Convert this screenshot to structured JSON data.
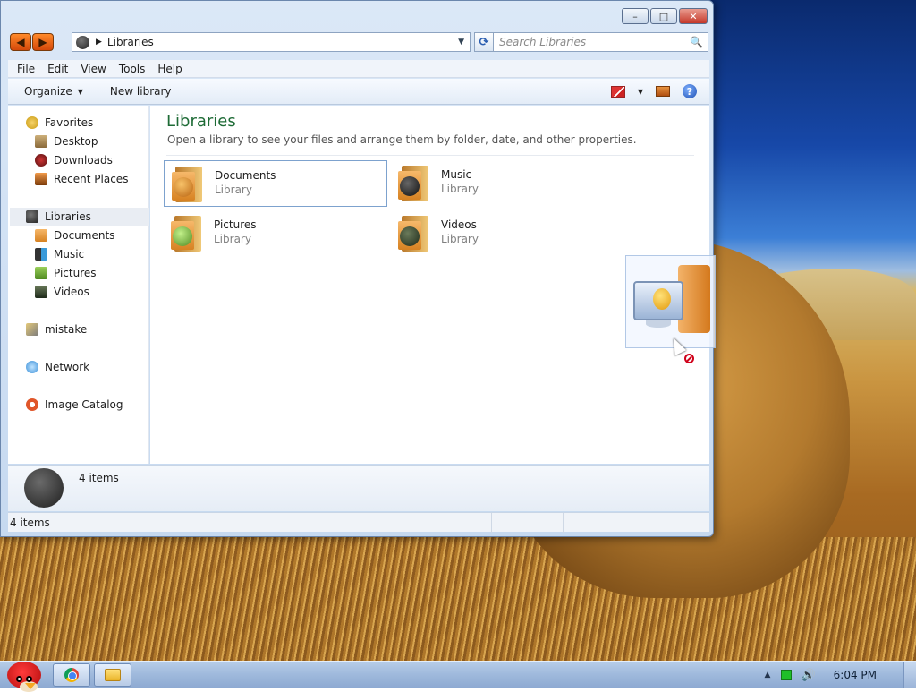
{
  "window": {
    "address_path": "Libraries",
    "search_placeholder": "Search Libraries",
    "caption": {
      "minimize": "–",
      "maximize": "□",
      "close": "✕"
    }
  },
  "menubar": [
    "File",
    "Edit",
    "View",
    "Tools",
    "Help"
  ],
  "toolbar": {
    "organize": "Organize",
    "new_library": "New library"
  },
  "sidebar": {
    "favorites": {
      "label": "Favorites",
      "items": [
        "Desktop",
        "Downloads",
        "Recent Places"
      ]
    },
    "libraries": {
      "label": "Libraries",
      "items": [
        "Documents",
        "Music",
        "Pictures",
        "Videos"
      ]
    },
    "homegroup": "mistake",
    "network": "Network",
    "image_catalog": "Image Catalog"
  },
  "content": {
    "title": "Libraries",
    "description": "Open a library to see your files and arrange them by folder, date, and other properties.",
    "libraries": [
      {
        "name": "Documents",
        "type": "Library",
        "badge_color": "#e0892a",
        "selected": true
      },
      {
        "name": "Music",
        "type": "Library",
        "badge_color": "#2f2f2f",
        "selected": false
      },
      {
        "name": "Pictures",
        "type": "Library",
        "badge_color": "#7fc24a",
        "selected": false
      },
      {
        "name": "Videos",
        "type": "Library",
        "badge_color": "#3d4a3a",
        "selected": false
      }
    ]
  },
  "details": {
    "count": "4 items"
  },
  "status": {
    "count": "4 items"
  },
  "taskbar": {
    "clock": "6:04 PM"
  }
}
